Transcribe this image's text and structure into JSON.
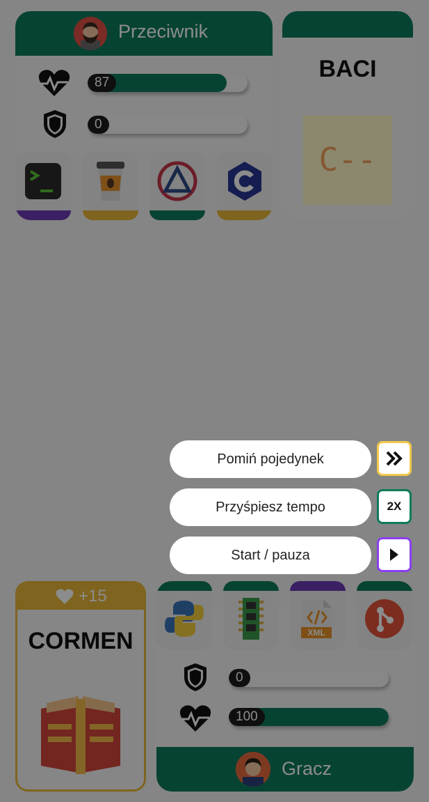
{
  "opponent": {
    "name": "Przeciwnik",
    "health": 87,
    "health_max": 100,
    "shield": 0,
    "cards": [
      {
        "icon": "terminal-icon",
        "color": "#6c3ab4"
      },
      {
        "icon": "coffee-cup-icon",
        "color": "#e8b73a"
      },
      {
        "icon": "triangle-logo-icon",
        "color": "#0e7a5b"
      },
      {
        "icon": "c-language-icon",
        "color": "#e8b73a"
      }
    ]
  },
  "opponent_play": {
    "title": "BACI",
    "card_text": "C--"
  },
  "controls": {
    "skip_label": "Pomiń pojedynek",
    "speed_label": "Przyśpiesz tempo",
    "speed_button": "2X",
    "startpause_label": "Start / pauza",
    "skip_color": "#f3c94b",
    "speed_color": "#0e7a5b",
    "startpause_color": "#8a3ff0"
  },
  "player_card": {
    "bonus": "+15",
    "title": "CORMEN"
  },
  "player": {
    "name": "Gracz",
    "shield": 0,
    "health": 100,
    "health_max": 100,
    "cards": [
      {
        "icon": "python-icon",
        "color": "#0e7a5b"
      },
      {
        "icon": "ram-icon",
        "color": "#0e7a5b"
      },
      {
        "icon": "xml-file-icon",
        "color": "#6c3ab4"
      },
      {
        "icon": "git-icon",
        "color": "#0e7a5b"
      }
    ],
    "xml_label": "XML"
  }
}
